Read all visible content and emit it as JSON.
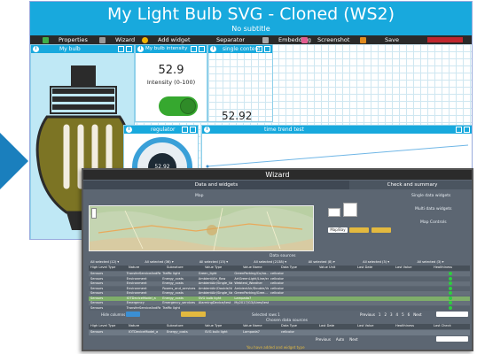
{
  "dashboard": {
    "title": "My Light Bulb SVG - Cloned (WS2)",
    "subtitle": "No subtitle",
    "toolbar": [
      "Properties",
      "Wizard",
      "Add widget",
      "Separator",
      "Embedding",
      "Screenshot",
      "Save"
    ],
    "widgets": {
      "bulb": {
        "title": "My bulb"
      },
      "intensity": {
        "title": "My bulb intensity",
        "value": "52.9",
        "label": "Intensity (0-100)",
        "value2": "52.92"
      },
      "single": {
        "title": "single content"
      },
      "regulator": {
        "title": "regulator",
        "knob_value": "52.92"
      },
      "trend": {
        "title": "time trend test"
      }
    }
  },
  "wizard": {
    "title": "Wizard",
    "tabs": [
      "Data and widgets",
      "Check and summary"
    ],
    "map_label": "Map",
    "right_labels": [
      "Single data widgets",
      "Multi data widgets",
      "Map Controls"
    ],
    "buttons": [
      "Map/Bay",
      "",
      ""
    ],
    "data_sources_label": "Data sources",
    "filter_headers": [
      "All selected (12) ▾",
      "All selected (36) ▾",
      "All selected (15) ▾",
      "All selected (2138) ▾",
      "All selected (8) ▾",
      "All selected (3) ▾",
      "All selected (3) ▾"
    ],
    "columns": [
      "High Level Type",
      "Nature",
      "Subnature",
      "Value Type",
      "Value Name",
      "Data Type",
      "Value Unit",
      "Last Date",
      "Last Value",
      "Healthiness"
    ],
    "rows": [
      [
        "Sensors",
        "TransferServiceAndRenting",
        "Traffic light",
        "Green_light",
        "GreenParking/Co/no...",
        "cellcolor",
        "",
        "",
        "",
        ""
      ],
      [
        "Sensors",
        "Environment",
        "Energy_costs",
        "Ambient/Air_flow",
        "ArtGreenLight/Line/en...",
        "cellcolor",
        "",
        "",
        "",
        ""
      ],
      [
        "Sensors",
        "Environment",
        "Energy_costs",
        "AmbientAir/Single_Value/...",
        "Webtest_Weather",
        "cellcolor",
        "",
        "",
        "",
        ""
      ],
      [
        "Sensors",
        "Environment",
        "Rooms_and_services",
        "AmbientAir/Double/Value/Amb...",
        "AmbientAir/Double/Value/Green Fieer",
        "cellcolor",
        "",
        "",
        "",
        ""
      ],
      [
        "Sensors",
        "Environment",
        "Energy_costs",
        "AmbientAir/Single_Value",
        "GreenParking/Gree...",
        "cellcolor",
        "",
        "",
        "",
        ""
      ],
      [
        "Sensors",
        "IOTDeviceModel_a",
        "Energy_costs",
        "SVG bulb light",
        "Lampada7",
        "",
        "",
        "",
        "",
        ""
      ],
      [
        "Sensors",
        "Emergency",
        "Emergency_services",
        "AlarmingDevice/test",
        "My2017/G3/Aires/testAuto",
        "",
        "",
        "",
        "",
        ""
      ],
      [
        "Sensors",
        "TransferServiceAndRenting",
        "Traffic light",
        "",
        "",
        "",
        "",
        "",
        "",
        ""
      ]
    ],
    "hide_columns": "Hide columns",
    "selected_rows": "Selected rows 1",
    "pagination": [
      "Previous",
      "1",
      "2",
      "3",
      "4",
      "5",
      "6",
      "Next"
    ],
    "chosen_label": "Chosen data sources",
    "chosen_columns": [
      "High Level Type",
      "Nature",
      "Subnature",
      "Value Type",
      "Value Name",
      "Data Type",
      "Last Date",
      "Last Value",
      "Healthiness",
      "Last Check"
    ],
    "chosen_row": [
      "Sensors",
      "IOTDeviceModel_a",
      "Energy_costs",
      "SVG bulb light",
      "Lampada7",
      "cellcolor",
      "",
      "",
      "",
      ""
    ],
    "chosen_pagination": [
      "Previous",
      "Auto",
      "Next"
    ],
    "footer_note": "You have added and widget type"
  }
}
